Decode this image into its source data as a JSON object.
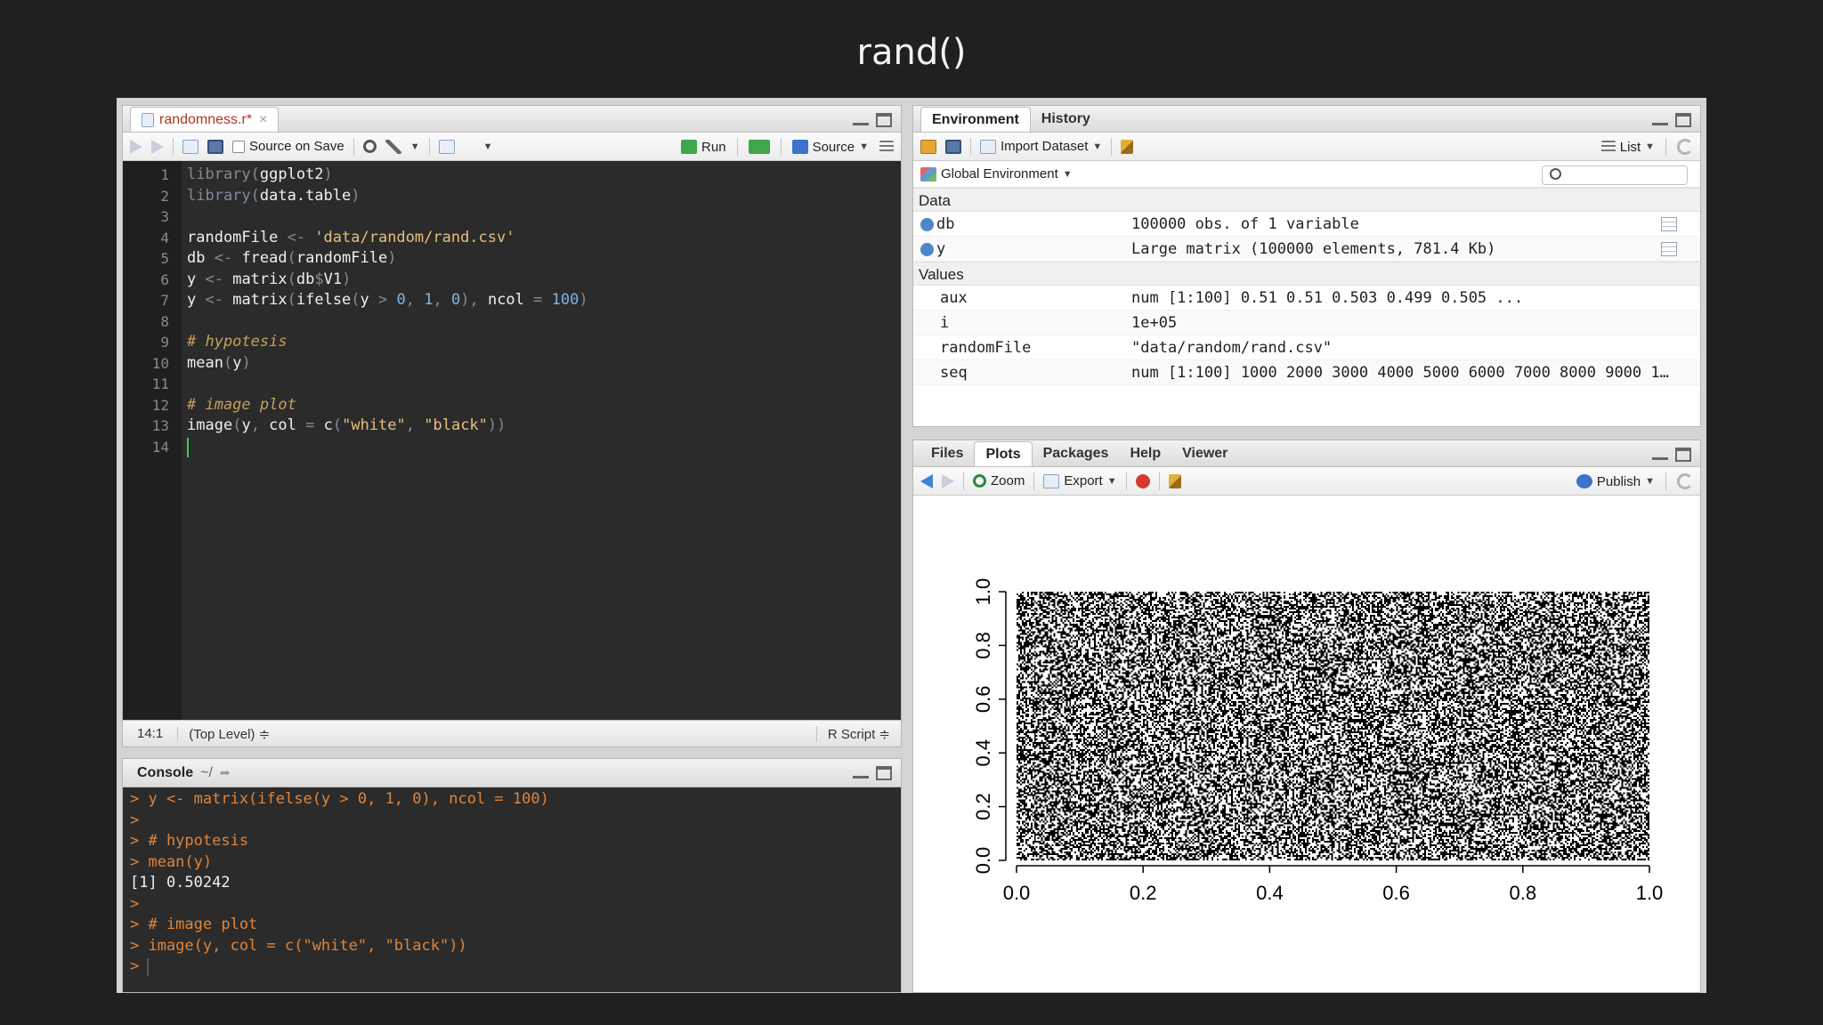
{
  "slide_title": "rand()",
  "source_pane": {
    "file_tab": "randomness.r*",
    "toolbar": {
      "source_on_save": "Source on Save",
      "run": "Run",
      "source": "Source"
    },
    "code_lines": [
      {
        "n": "1",
        "code": [
          [
            "library(",
            "p"
          ],
          [
            "ggplot2",
            "n"
          ],
          [
            ")",
            "p"
          ]
        ]
      },
      {
        "n": "2",
        "code": [
          [
            "library(",
            "p"
          ],
          [
            "data.table",
            "n"
          ],
          [
            ")",
            "p"
          ]
        ]
      },
      {
        "n": "3",
        "code": []
      },
      {
        "n": "4",
        "code": [
          [
            "randomFile ",
            "n"
          ],
          [
            "<- ",
            "op"
          ],
          [
            "'data/random/rand.csv'",
            "s"
          ]
        ]
      },
      {
        "n": "5",
        "code": [
          [
            "db ",
            "n"
          ],
          [
            "<- ",
            "op"
          ],
          [
            "fread",
            "n"
          ],
          [
            "(",
            "p"
          ],
          [
            "randomFile",
            "n"
          ],
          [
            ")",
            "p"
          ]
        ]
      },
      {
        "n": "6",
        "code": [
          [
            "y ",
            "n"
          ],
          [
            "<- ",
            "op"
          ],
          [
            "matrix",
            "n"
          ],
          [
            "(",
            "p"
          ],
          [
            "db",
            "n"
          ],
          [
            "$",
            "op"
          ],
          [
            "V1",
            "n"
          ],
          [
            ")",
            "p"
          ]
        ]
      },
      {
        "n": "7",
        "code": [
          [
            "y ",
            "n"
          ],
          [
            "<- ",
            "op"
          ],
          [
            "matrix",
            "n"
          ],
          [
            "(",
            "p"
          ],
          [
            "ifelse",
            "n"
          ],
          [
            "(",
            "p"
          ],
          [
            "y ",
            "n"
          ],
          [
            "> ",
            "op"
          ],
          [
            "0",
            "num"
          ],
          [
            ", ",
            "p"
          ],
          [
            "1",
            "num"
          ],
          [
            ", ",
            "p"
          ],
          [
            "0",
            "num"
          ],
          [
            "), ",
            "p"
          ],
          [
            "ncol ",
            "n"
          ],
          [
            "= ",
            "op"
          ],
          [
            "100",
            "num"
          ],
          [
            ")",
            "p"
          ]
        ]
      },
      {
        "n": "8",
        "code": []
      },
      {
        "n": "9",
        "code": [
          [
            "# hypotesis",
            "c"
          ]
        ]
      },
      {
        "n": "10",
        "code": [
          [
            "mean",
            "n"
          ],
          [
            "(",
            "p"
          ],
          [
            "y",
            "n"
          ],
          [
            ")",
            "p"
          ]
        ]
      },
      {
        "n": "11",
        "code": []
      },
      {
        "n": "12",
        "code": [
          [
            "# image plot",
            "c"
          ]
        ]
      },
      {
        "n": "13",
        "code": [
          [
            "image",
            "n"
          ],
          [
            "(",
            "p"
          ],
          [
            "y",
            "n"
          ],
          [
            ", ",
            "p"
          ],
          [
            "col ",
            "n"
          ],
          [
            "= ",
            "op"
          ],
          [
            "c",
            "n"
          ],
          [
            "(",
            "p"
          ],
          [
            "\"white\"",
            "s"
          ],
          [
            ", ",
            "p"
          ],
          [
            "\"black\"",
            "s"
          ],
          [
            "))",
            "p"
          ]
        ]
      },
      {
        "n": "14",
        "code": []
      }
    ],
    "status": {
      "position": "14:1",
      "scope": "(Top Level) ≑",
      "filetype": "R Script ≑"
    }
  },
  "console_pane": {
    "title": "Console",
    "path": "~/",
    "lines": [
      {
        "text": "> y <- matrix(ifelse(y > 0, 1, 0), ncol = 100)",
        "kind": "in"
      },
      {
        "text": ">",
        "kind": "in"
      },
      {
        "text": "> # hypotesis",
        "kind": "in"
      },
      {
        "text": "> mean(y)",
        "kind": "in"
      },
      {
        "text": "[1] 0.50242",
        "kind": "out"
      },
      {
        "text": ">",
        "kind": "in"
      },
      {
        "text": "> # image plot",
        "kind": "in"
      },
      {
        "text": "> image(y, col = c(\"white\", \"black\"))",
        "kind": "in"
      },
      {
        "text": ">",
        "kind": "in"
      }
    ]
  },
  "env_pane": {
    "tabs": [
      "Environment",
      "History"
    ],
    "toolbar": {
      "import": "Import Dataset",
      "list": "List",
      "scope": "Global Environment"
    },
    "data_label": "Data",
    "data_rows": [
      {
        "name": "db",
        "value": "100000 obs. of 1 variable"
      },
      {
        "name": "y",
        "value": "Large matrix (100000 elements, 781.4 Kb)"
      }
    ],
    "values_label": "Values",
    "value_rows": [
      {
        "name": "aux",
        "value": "num [1:100] 0.51 0.51 0.503 0.499 0.505 ..."
      },
      {
        "name": "i",
        "value": "1e+05"
      },
      {
        "name": "randomFile",
        "value": "\"data/random/rand.csv\""
      },
      {
        "name": "seq",
        "value": "num [1:100] 1000 2000 3000 4000 5000 6000 7000 8000 9000 100…"
      }
    ]
  },
  "files_pane": {
    "tabs": [
      "Files",
      "Plots",
      "Packages",
      "Help",
      "Viewer"
    ],
    "toolbar": {
      "zoom": "Zoom",
      "export": "Export",
      "publish": "Publish"
    }
  },
  "chart_data": {
    "type": "heatmap",
    "description_values": "random binary image, 1000 rows x 100 cols of 0/1, mean 0.50242",
    "colors": [
      "#ffffff",
      "#000000"
    ],
    "xlim": [
      0,
      1
    ],
    "ylim": [
      0,
      1
    ],
    "x_ticks": [
      "0.0",
      "0.2",
      "0.4",
      "0.6",
      "0.8",
      "1.0"
    ],
    "y_ticks": [
      "0.0",
      "0.2",
      "0.4",
      "0.6",
      "0.8",
      "1.0"
    ],
    "xlabel": "",
    "ylabel": ""
  }
}
